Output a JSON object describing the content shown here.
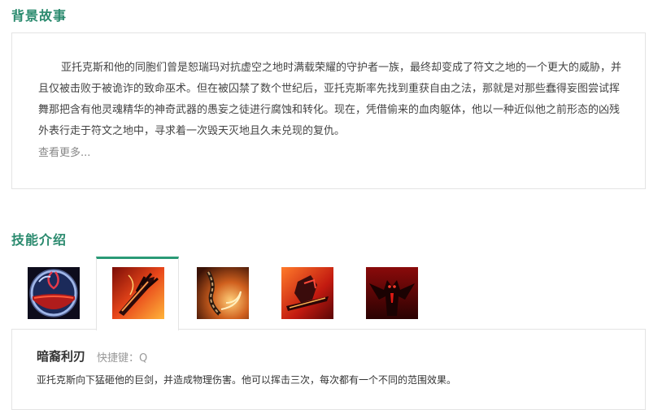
{
  "background": {
    "title": "背景故事",
    "story": "亚托克斯和他的同胞们曾是恕瑞玛对抗虚空之地时满载荣耀的守护者一族，最终却变成了符文之地的一个更大的威胁，并且仅被击败于被诡诈的致命巫术。但在被囚禁了数个世纪后，亚托克斯率先找到重获自由之法，那就是对那些蠢得妄图尝试挥舞那把含有他灵魂精华的神奇武器的愚妄之徒进行腐蚀和转化。现在，凭借偷来的血肉躯体，他以一种近似他之前形态的凶残外表行走于符文之地中，寻求着一次毁天灭地且久未兑现的复仇。",
    "more_link": "查看更多..."
  },
  "skills": {
    "title": "技能介绍",
    "tabs": [
      {
        "icon": "passive-blood-orb-icon",
        "active": false
      },
      {
        "icon": "dark-blade-icon",
        "active": true
      },
      {
        "icon": "chain-swirl-icon",
        "active": false
      },
      {
        "icon": "umbral-dash-icon",
        "active": false
      },
      {
        "icon": "world-ender-icon",
        "active": false
      }
    ],
    "selected": {
      "name": "暗裔利刃",
      "key_label": "快捷键：Q",
      "description": "亚托克斯向下猛砸他的巨剑，并造成物理伤害。他可以挥击三次，每次都有一个不同的范围效果。"
    }
  },
  "colors": {
    "accent": "#2a8a6e",
    "tab_active_border": "#2a9a76"
  }
}
